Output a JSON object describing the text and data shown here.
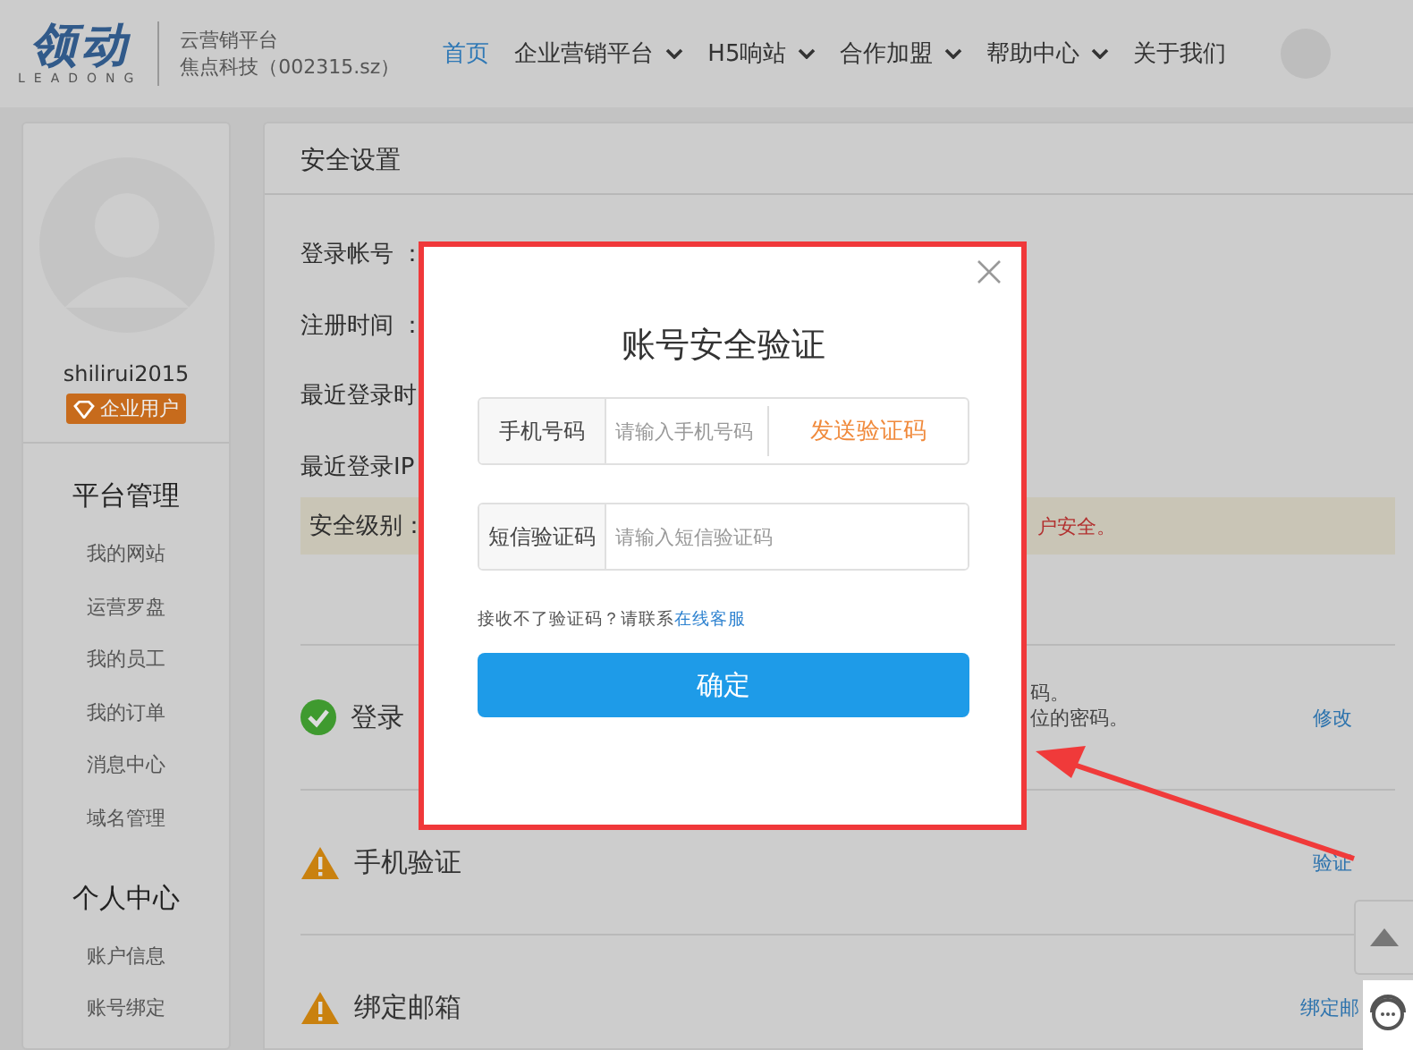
{
  "header": {
    "logo": {
      "mark": "领动",
      "sub": "LEADONG"
    },
    "tagline": [
      "云营销平台",
      "焦点科技（002315.sz）"
    ],
    "nav": [
      {
        "label": "首页",
        "selected": true,
        "dropdown": false
      },
      {
        "label": "企业营销平台",
        "selected": false,
        "dropdown": true
      },
      {
        "label": "H5响站",
        "selected": false,
        "dropdown": true
      },
      {
        "label": "合作加盟",
        "selected": false,
        "dropdown": true
      },
      {
        "label": "帮助中心",
        "selected": false,
        "dropdown": true
      },
      {
        "label": "关于我们",
        "selected": false,
        "dropdown": false
      }
    ]
  },
  "sidebar": {
    "username": "shilirui2015",
    "badge": "企业用户",
    "sections": [
      {
        "title": "平台管理",
        "items": [
          "我的网站",
          "运营罗盘",
          "我的员工",
          "我的订单",
          "消息中心",
          "域名管理"
        ]
      },
      {
        "title": "个人中心",
        "items": [
          "账户信息",
          "账号绑定"
        ]
      }
    ]
  },
  "panel": {
    "title": "安全设置",
    "info": [
      "登录帐号 ：",
      "注册时间 ：",
      "最近登录时",
      "最近登录IP"
    ],
    "security_level": {
      "label": "安全级别：",
      "note": "户安全。"
    },
    "items": [
      {
        "kind": "ok",
        "title": "登录",
        "desc": [
          "码。",
          "位的密码。"
        ],
        "action": "修改"
      },
      {
        "kind": "warning",
        "title": "手机验证",
        "action": "验证"
      },
      {
        "kind": "warning",
        "title": "绑定邮箱",
        "action": "绑定邮"
      }
    ]
  },
  "dialog": {
    "title": "账号安全验证",
    "fields": [
      {
        "label": "手机号码",
        "placeholder": "请输入手机号码",
        "button": "发送验证码"
      },
      {
        "label": "短信验证码",
        "placeholder": "请输入短信验证码"
      }
    ],
    "help": "接收不了验证码？请联系",
    "help_link": "在线客服",
    "confirm": "确定"
  }
}
